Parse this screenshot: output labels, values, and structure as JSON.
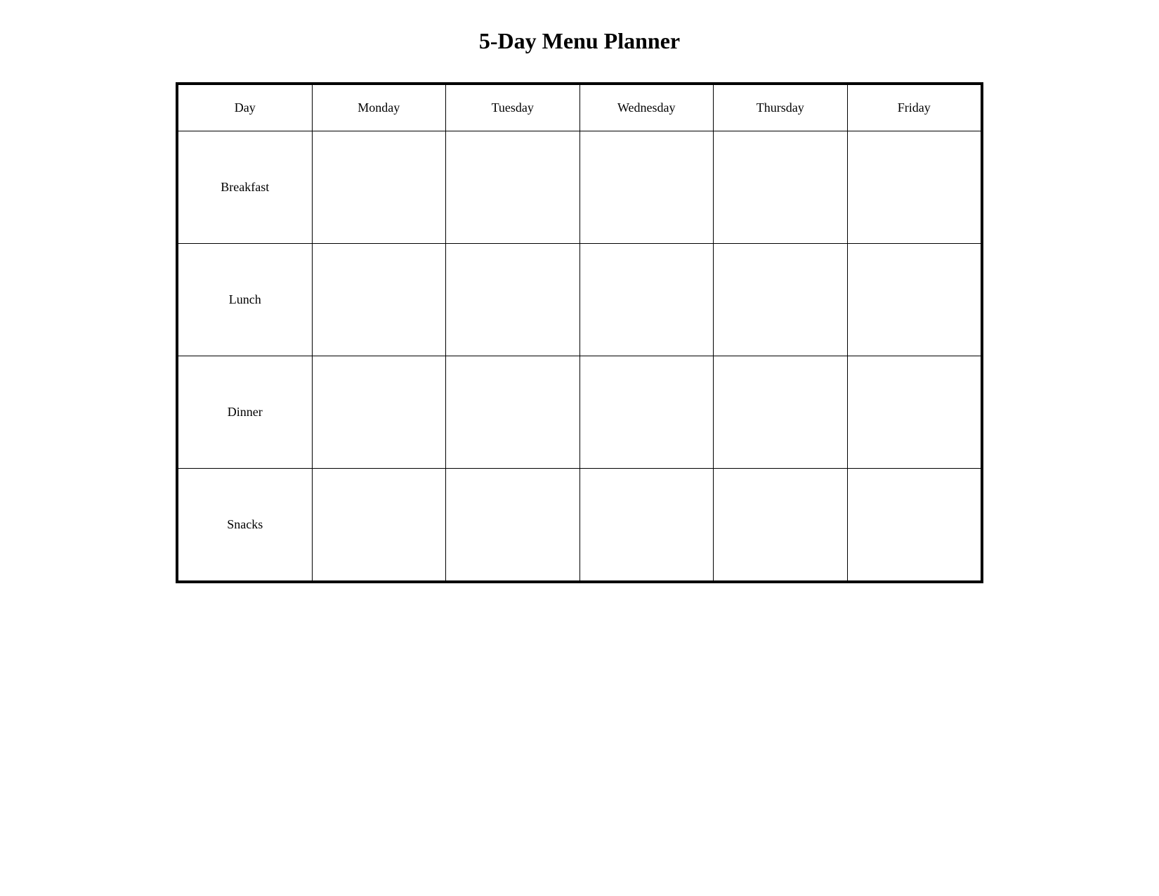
{
  "title": "5-Day Menu Planner",
  "table": {
    "columns": [
      {
        "id": "day",
        "label": "Day"
      },
      {
        "id": "monday",
        "label": "Monday"
      },
      {
        "id": "tuesday",
        "label": "Tuesday"
      },
      {
        "id": "wednesday",
        "label": "Wednesday"
      },
      {
        "id": "thursday",
        "label": "Thursday"
      },
      {
        "id": "friday",
        "label": "Friday"
      }
    ],
    "rows": [
      {
        "label": "Breakfast"
      },
      {
        "label": "Lunch"
      },
      {
        "label": "Dinner"
      },
      {
        "label": "Snacks"
      }
    ]
  }
}
